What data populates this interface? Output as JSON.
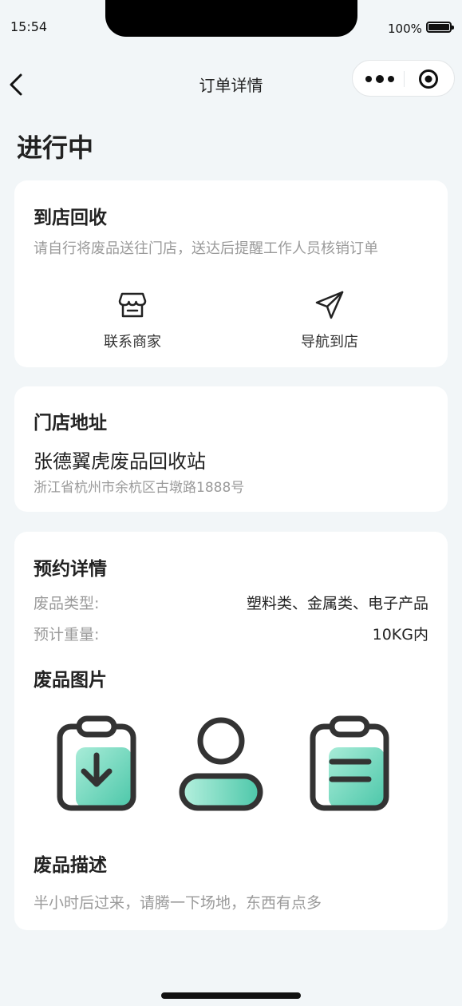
{
  "status_bar": {
    "time": "15:54",
    "battery": "100%"
  },
  "nav": {
    "title": "订单详情"
  },
  "order_status": "进行中",
  "pickup": {
    "title": "到店回收",
    "description": "请自行将废品送往门店，送达后提醒工作人员核销订单",
    "actions": [
      {
        "label": "联系商家",
        "icon": "store-icon"
      },
      {
        "label": "导航到店",
        "icon": "navigation-icon"
      }
    ]
  },
  "store": {
    "title": "门店地址",
    "name": "张德翼虎废品回收站",
    "address": "浙江省杭州市余杭区古墩路1888号"
  },
  "booking": {
    "title": "预约详情",
    "rows": [
      {
        "label": "废品类型:",
        "value": "塑料类、金属类、电子产品"
      },
      {
        "label": "预计重量:",
        "value": "10KG内"
      }
    ],
    "images_title": "废品图片",
    "images": [
      "clipboard-download-icon",
      "user-icon",
      "clipboard-list-icon"
    ],
    "desc_title": "废品描述",
    "description": "半小时后过来，请腾一下场地，东西有点多"
  },
  "colors": {
    "accent": "#5ed0b4",
    "background": "#f2f6f8"
  }
}
